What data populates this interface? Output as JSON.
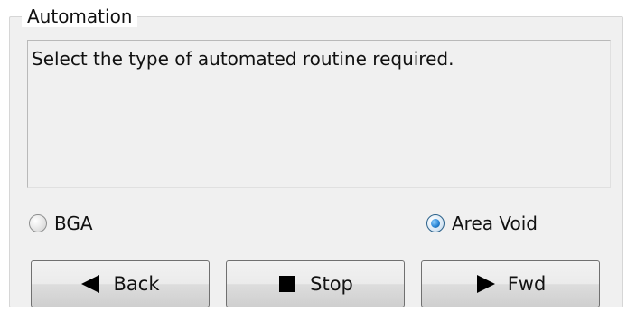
{
  "group": {
    "title": "Automation",
    "message": "Select the type of automated routine required."
  },
  "routine_type": {
    "options": [
      {
        "label": "BGA",
        "selected": false
      },
      {
        "label": "Area Void",
        "selected": true
      }
    ]
  },
  "buttons": {
    "back": "Back",
    "stop": "Stop",
    "fwd": "Fwd"
  },
  "icons": {
    "back": "triangle-left-icon",
    "stop": "square-stop-icon",
    "fwd": "triangle-right-icon"
  },
  "colors": {
    "radio_selected": "#2a86d6"
  }
}
